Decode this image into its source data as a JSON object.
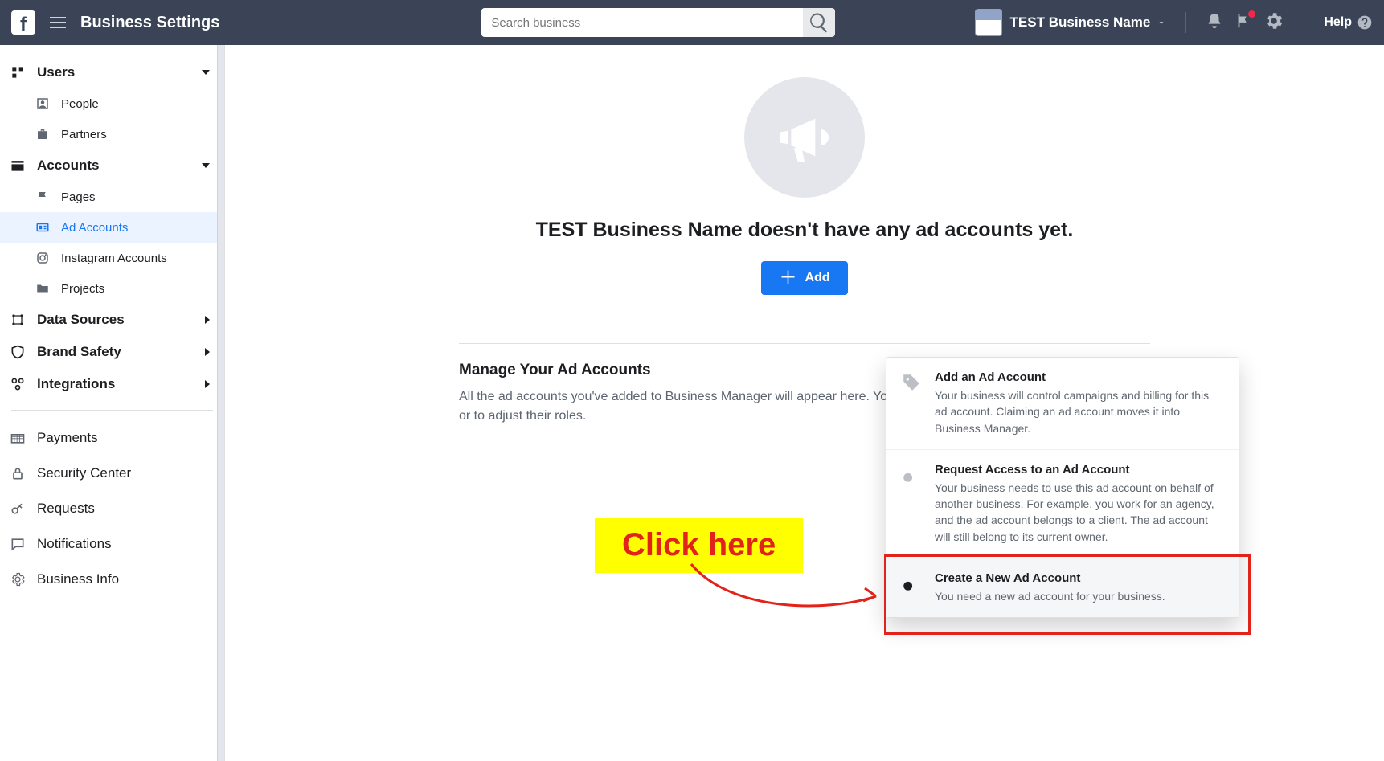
{
  "topbar": {
    "title": "Business Settings",
    "search_placeholder": "Search business",
    "business_name": "TEST Business Name",
    "help_label": "Help"
  },
  "sidebar": {
    "users": {
      "label": "Users",
      "children": {
        "people": "People",
        "partners": "Partners"
      }
    },
    "accounts": {
      "label": "Accounts",
      "children": {
        "pages": "Pages",
        "ad_accounts": "Ad Accounts",
        "instagram": "Instagram Accounts",
        "projects": "Projects"
      }
    },
    "data_sources": "Data Sources",
    "brand_safety": "Brand Safety",
    "integrations": "Integrations",
    "payments": "Payments",
    "security": "Security Center",
    "requests": "Requests",
    "notifications": "Notifications",
    "business_info": "Business Info"
  },
  "main": {
    "hero_title": "TEST Business Name doesn't have any ad accounts yet.",
    "add_button": "Add",
    "manage_title": "Manage Your Ad Accounts",
    "manage_desc": "All the ad accounts you've added to Business Manager will appear here. You can manage the people who need access, or to adjust their roles."
  },
  "dropdown": {
    "add": {
      "title": "Add an Ad Account",
      "desc": "Your business will control campaigns and billing for this ad account. Claiming an ad account moves it into Business Manager."
    },
    "request": {
      "title": "Request Access to an Ad Account",
      "desc": "Your business needs to use this ad account on behalf of another business. For example, you work for an agency, and the ad account belongs to a client. The ad account will still belong to its current owner."
    },
    "create": {
      "title": "Create a New Ad Account",
      "desc": "You need a new ad account for your business."
    }
  },
  "annotation": {
    "click_here": "Click here"
  }
}
